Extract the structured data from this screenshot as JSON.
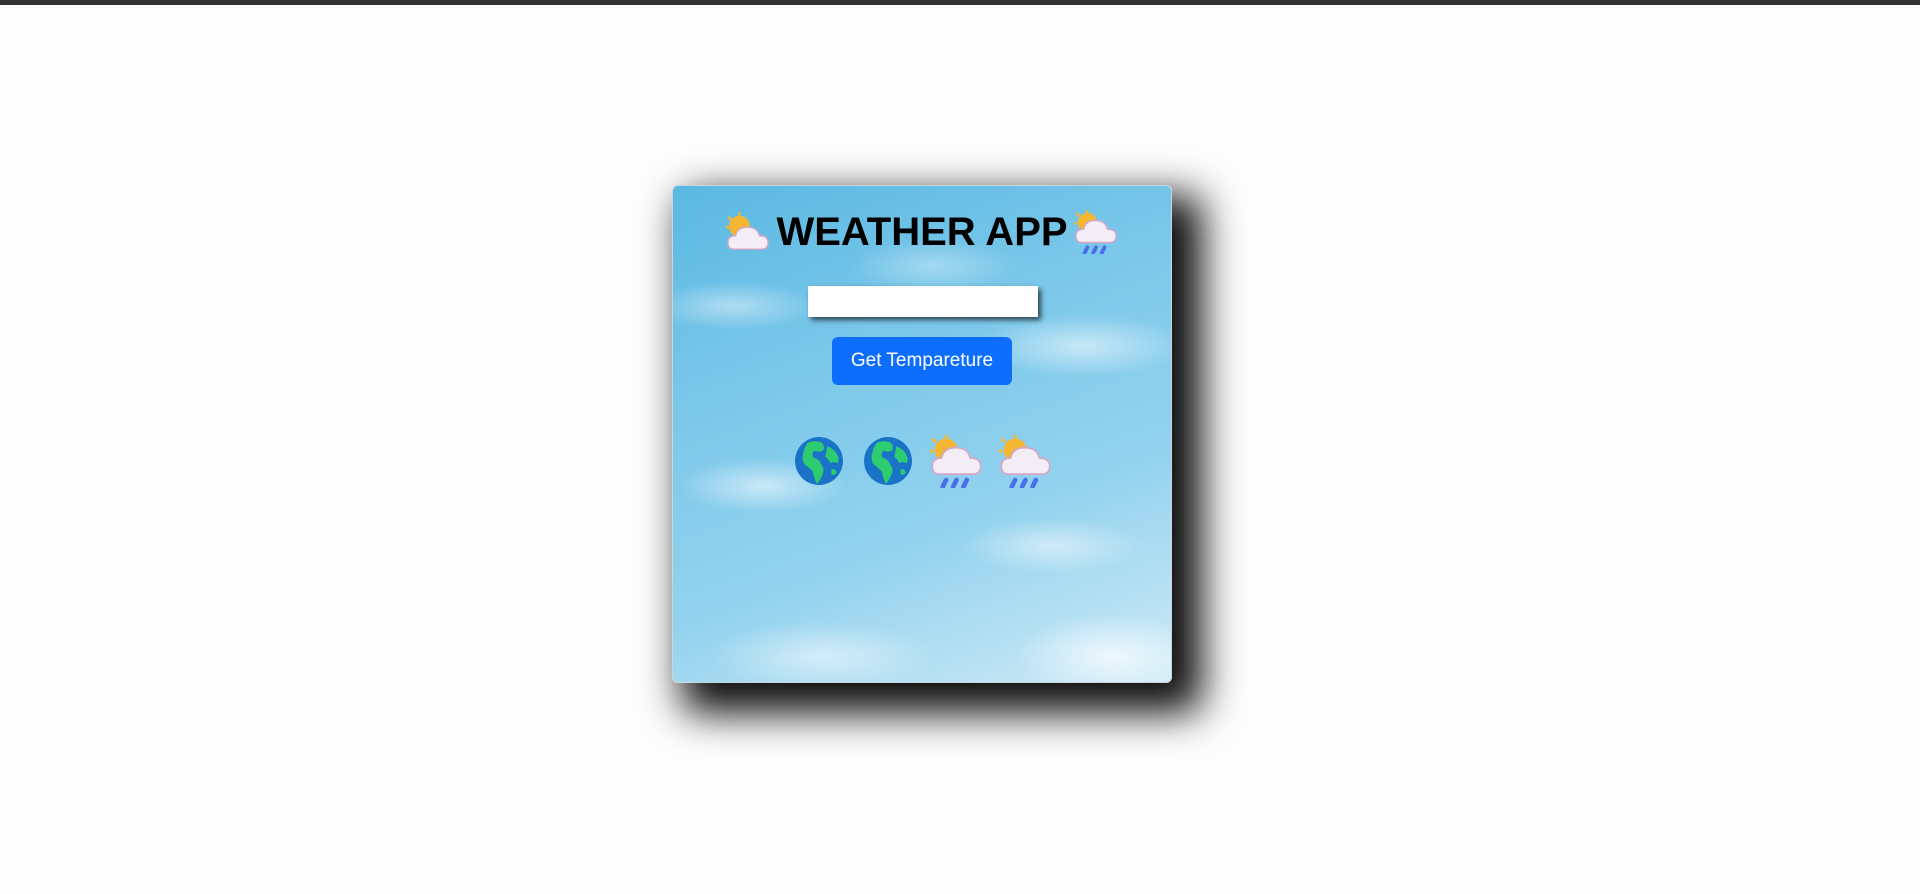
{
  "app": {
    "title": "WEATHER APP",
    "title_left_icon": "sun-behind-cloud-icon",
    "title_right_icon": "cloud-with-rain-icon"
  },
  "search": {
    "value": "",
    "placeholder": ""
  },
  "button": {
    "label": "Get Tempareture",
    "color": "#0d6efd"
  },
  "results": {
    "icons": [
      "globe-africa-europe-icon",
      "globe-africa-europe-icon",
      "sun-behind-rain-cloud-icon",
      "sun-behind-rain-cloud-icon"
    ]
  },
  "colors": {
    "card_sky": "#7cc8ea",
    "title_text": "#000000",
    "top_bar": "#333333"
  }
}
